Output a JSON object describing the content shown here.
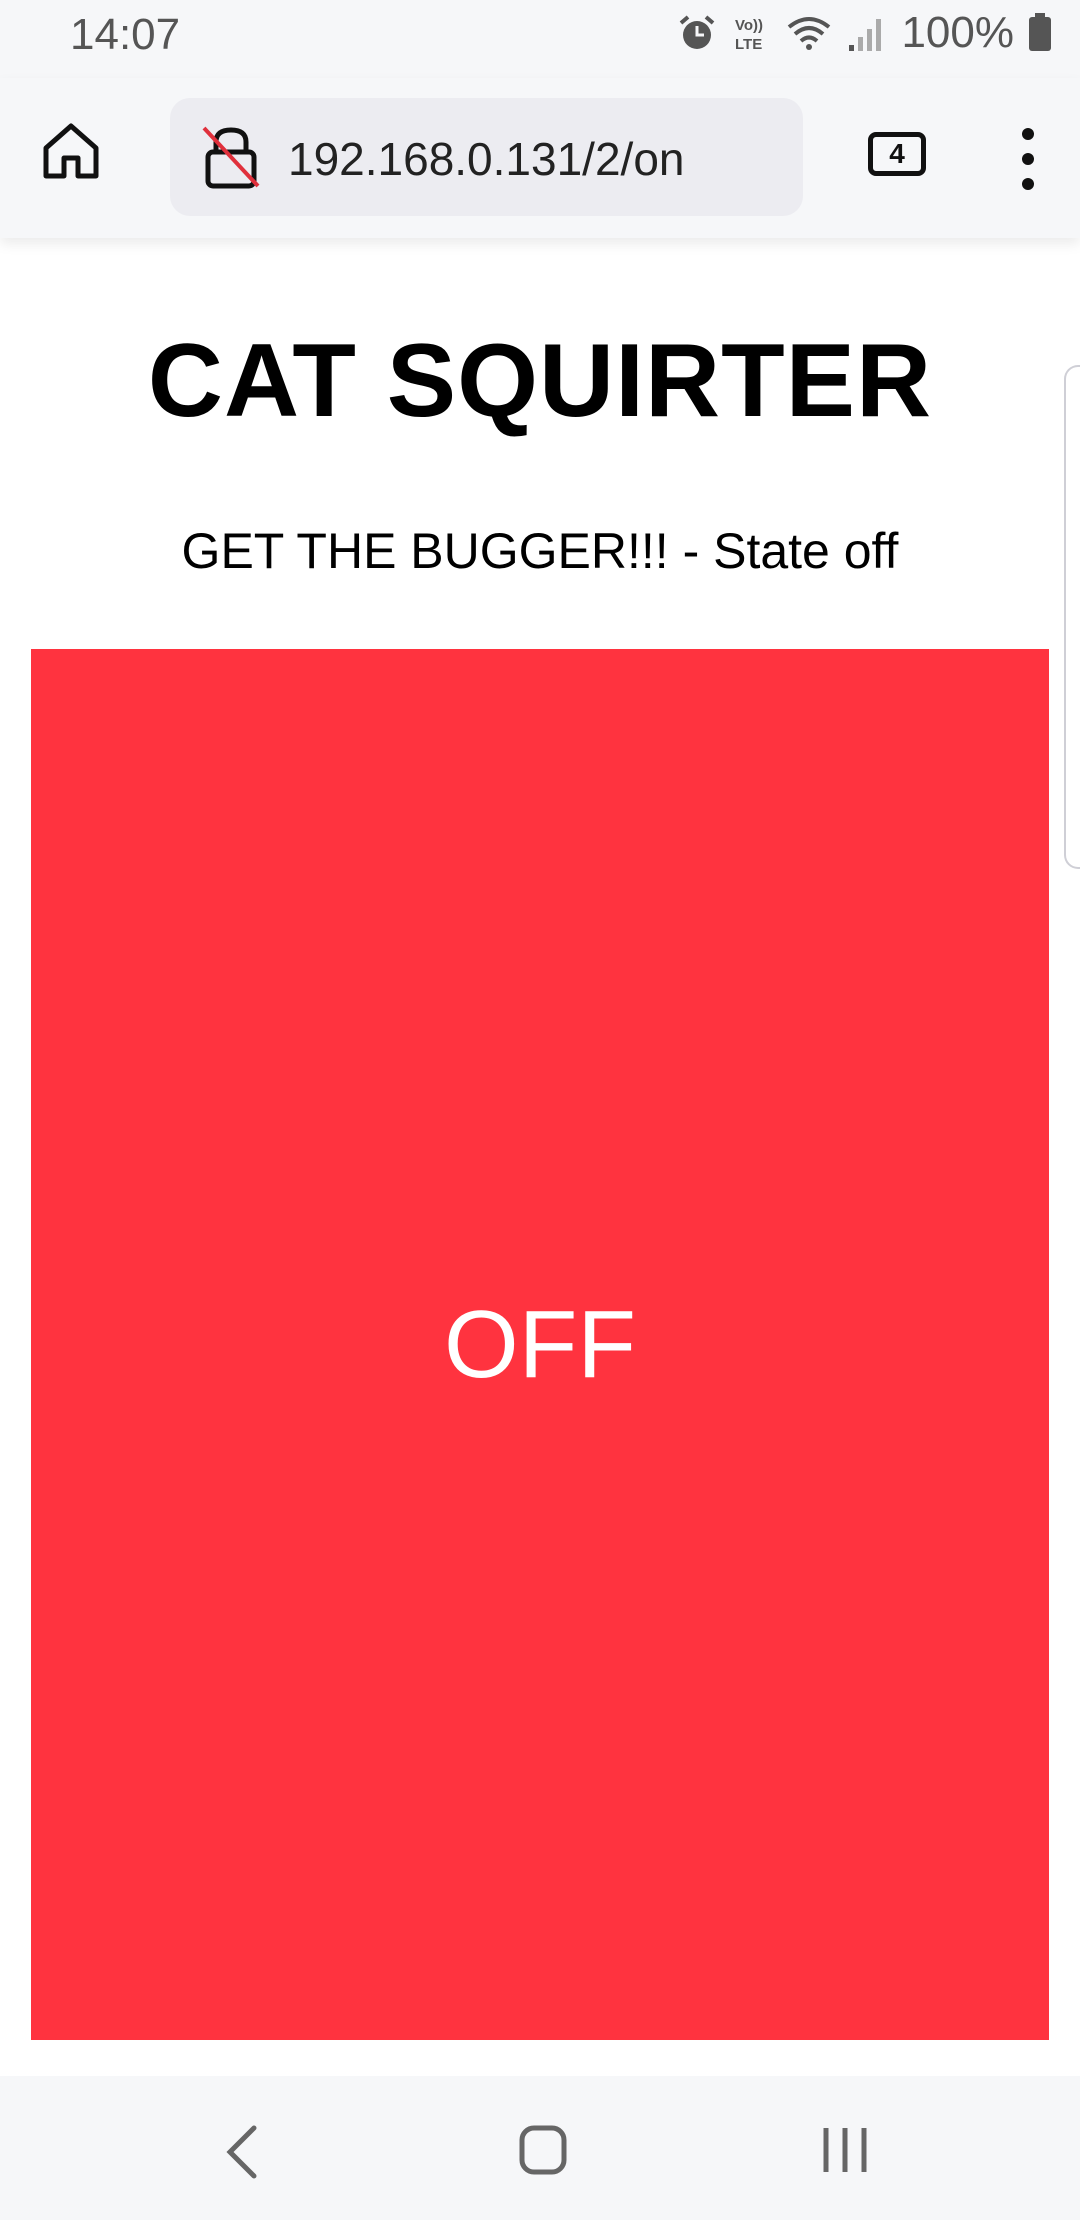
{
  "status_bar": {
    "time": "14:07",
    "battery": "100%",
    "icons": [
      "alarm-icon",
      "volte-icon",
      "wifi-icon",
      "signal-icon",
      "battery-icon"
    ]
  },
  "browser": {
    "url": "192.168.0.131/2/on",
    "tab_count": "4",
    "icons": [
      "home-icon",
      "insecure-lock-icon",
      "tabs-icon",
      "more-menu-icon"
    ]
  },
  "page": {
    "title": "CAT SQUIRTER",
    "subtitle": "GET THE BUGGER!!! - State off",
    "button_label": "OFF",
    "button_color": "#ff333f"
  },
  "nav_bar": {
    "icons": [
      "back-icon",
      "home-nav-icon",
      "recents-icon"
    ]
  }
}
